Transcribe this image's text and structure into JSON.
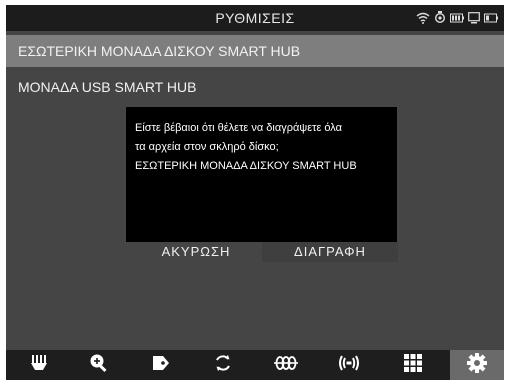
{
  "header": {
    "title": "ΡΥΘΜΙΣΕΙΣ",
    "status_icons": [
      "wifi-icon",
      "bulb-icon",
      "battery-dots-icon",
      "monitor-icon",
      "battery-icon"
    ]
  },
  "list": {
    "items": [
      {
        "label": "ΕΣΩΤΕΡΙΚΗ ΜΟΝΑΔΑ ΔΙΣΚΟΥ SMART HUB",
        "selected": true
      },
      {
        "label": "ΜΟΝΑΔΑ USB SMART HUB",
        "selected": false
      }
    ]
  },
  "dialog": {
    "lines": [
      "Είστε βέβαιοι ότι θέλετε να διαγράψετε όλα",
      "τα αρχεία στον σκληρό δίσκο;",
      "ΕΣΩΤΕΡΙΚΗ ΜΟΝΑΔΑ ΔΙΣΚΟΥ SMART HUB"
    ],
    "cancel_label": "ΑΚΥΡΩΣΗ",
    "delete_label": "ΔΙΑΓΡΑΦΗ"
  },
  "tabs": [
    {
      "icon": "comb-icon",
      "active": false
    },
    {
      "icon": "zoom-in-icon",
      "active": false
    },
    {
      "icon": "tag-icon",
      "active": false
    },
    {
      "icon": "rotate-icon",
      "active": false
    },
    {
      "icon": "triple-loop-icon",
      "active": false
    },
    {
      "icon": "signal-icon",
      "active": false
    },
    {
      "icon": "grid-icon",
      "active": false
    },
    {
      "icon": "gear-icon",
      "active": true
    }
  ],
  "colors": {
    "background": "#454545",
    "selected_row": "#7e7e7e",
    "dialog": "#000000",
    "top_bar": "#1c1c1c",
    "bottom_bar": "#1e1e1e",
    "active_tab": "#6a6a6a"
  }
}
